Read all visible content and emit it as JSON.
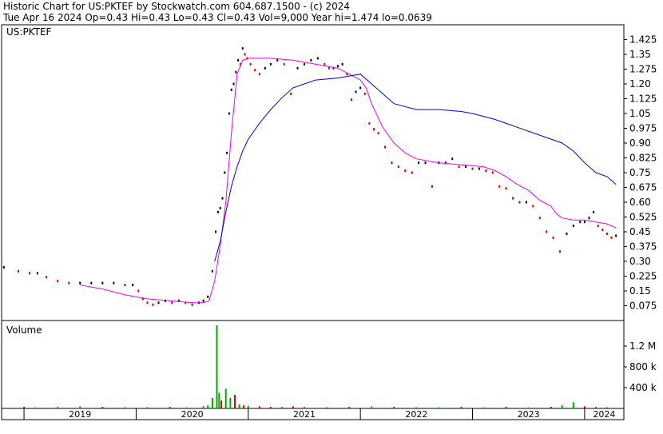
{
  "header": {
    "line1": "Historic Chart for US:PKTEF by Stockwatch.com 604.687.1500 - (c) 2024",
    "line2": "Tue Apr 16 2024  Op=0.43  Hi=0.43  Lo=0.43  Cl=0.43  Vol=9,000  Year hi=1.474  lo=0.0639"
  },
  "colors": {
    "up": "#000000",
    "down": "#cc0000",
    "ma_short": "#ee00ee",
    "ma_long": "#0000cc",
    "vol_up": "#00aa00",
    "vol_down": "#cc0000"
  },
  "chart_data": [
    {
      "type": "line",
      "symbol_label": "US:PKTEF",
      "x_ticks": [
        "2019",
        "2020",
        "2021",
        "2022",
        "2023",
        "2024"
      ],
      "x_range": [
        2018.8,
        2024.35
      ],
      "y_ticks": [
        "1.425",
        "1.35",
        "1.275",
        "1.20",
        "1.125",
        "1.05",
        "0.975",
        "0.90",
        "0.825",
        "0.75",
        "0.675",
        "0.60",
        "0.525",
        "0.45",
        "0.375",
        "0.30",
        "0.225",
        "0.15",
        "0.075"
      ],
      "ylim": [
        0,
        1.5
      ],
      "series": [
        {
          "name": "",
          "role": "close",
          "x": [
            2018.82,
            2018.95,
            2019.05,
            2019.12,
            2019.2,
            2019.3,
            2019.4,
            2019.5,
            2019.6,
            2019.7,
            2019.8,
            2019.9,
            2019.97,
            2020.02,
            2020.06,
            2020.1,
            2020.15,
            2020.2,
            2020.26,
            2020.32,
            2020.38,
            2020.44,
            2020.5,
            2020.56,
            2020.6,
            2020.64,
            2020.68,
            2020.71,
            2020.73,
            2020.75,
            2020.77,
            2020.79,
            2020.81,
            2020.83,
            2020.85,
            2020.87,
            2020.89,
            2020.91,
            2020.93,
            2020.95,
            2020.97,
            2020.99,
            2021.02,
            2021.06,
            2021.1,
            2021.15,
            2021.2,
            2021.26,
            2021.32,
            2021.38,
            2021.44,
            2021.5,
            2021.56,
            2021.62,
            2021.68,
            2021.72,
            2021.76,
            2021.8,
            2021.84,
            2021.88,
            2021.92,
            2021.96,
            2022.0,
            2022.04,
            2022.08,
            2022.12,
            2022.16,
            2022.22,
            2022.28,
            2022.34,
            2022.4,
            2022.46,
            2022.52,
            2022.58,
            2022.64,
            2022.7,
            2022.76,
            2022.82,
            2022.88,
            2022.94,
            2023.0,
            2023.06,
            2023.12,
            2023.18,
            2023.24,
            2023.3,
            2023.36,
            2023.42,
            2023.48,
            2023.54,
            2023.6,
            2023.66,
            2023.72,
            2023.78,
            2023.84,
            2023.9,
            2023.96,
            2024.0,
            2024.04,
            2024.08,
            2024.12,
            2024.16,
            2024.2,
            2024.24,
            2024.28
          ],
          "values": [
            0.27,
            0.25,
            0.24,
            0.24,
            0.22,
            0.2,
            0.19,
            0.19,
            0.19,
            0.19,
            0.19,
            0.18,
            0.18,
            0.15,
            0.11,
            0.09,
            0.08,
            0.09,
            0.1,
            0.09,
            0.1,
            0.09,
            0.08,
            0.09,
            0.1,
            0.12,
            0.25,
            0.45,
            0.55,
            0.57,
            0.62,
            0.75,
            0.85,
            1.05,
            1.17,
            1.2,
            1.26,
            1.32,
            1.3,
            1.38,
            1.35,
            1.33,
            1.3,
            1.27,
            1.25,
            1.28,
            1.3,
            1.32,
            1.3,
            1.15,
            1.28,
            1.3,
            1.32,
            1.33,
            1.3,
            1.28,
            1.28,
            1.29,
            1.3,
            1.25,
            1.12,
            1.16,
            1.18,
            1.15,
            1.0,
            0.97,
            0.95,
            0.88,
            0.8,
            0.78,
            0.76,
            0.75,
            0.8,
            0.8,
            0.68,
            0.8,
            0.8,
            0.82,
            0.78,
            0.78,
            0.77,
            0.77,
            0.76,
            0.75,
            0.68,
            0.67,
            0.62,
            0.6,
            0.6,
            0.58,
            0.52,
            0.45,
            0.42,
            0.35,
            0.44,
            0.48,
            0.5,
            0.5,
            0.52,
            0.55,
            0.48,
            0.46,
            0.44,
            0.42,
            0.43
          ]
        },
        {
          "name": "",
          "role": "moving-average-short",
          "x": [
            2019.5,
            2019.7,
            2019.9,
            2020.1,
            2020.3,
            2020.5,
            2020.6,
            2020.65,
            2020.7,
            2020.75,
            2020.8,
            2020.85,
            2020.9,
            2020.95,
            2021.0,
            2021.2,
            2021.4,
            2021.6,
            2021.8,
            2021.9,
            2022.0,
            2022.05,
            2022.1,
            2022.2,
            2022.3,
            2022.4,
            2022.5,
            2022.7,
            2022.9,
            2023.1,
            2023.2,
            2023.3,
            2023.4,
            2023.5,
            2023.6,
            2023.7,
            2023.75,
            2023.8,
            2023.9,
            2024.0,
            2024.1,
            2024.2,
            2024.28
          ],
          "values": [
            0.18,
            0.16,
            0.13,
            0.11,
            0.1,
            0.09,
            0.09,
            0.1,
            0.2,
            0.38,
            0.6,
            0.95,
            1.25,
            1.32,
            1.33,
            1.33,
            1.32,
            1.3,
            1.28,
            1.25,
            1.22,
            1.18,
            1.1,
            0.98,
            0.9,
            0.85,
            0.82,
            0.8,
            0.79,
            0.78,
            0.76,
            0.73,
            0.69,
            0.66,
            0.61,
            0.58,
            0.54,
            0.52,
            0.51,
            0.51,
            0.5,
            0.49,
            0.47
          ]
        },
        {
          "name": "",
          "role": "moving-average-long",
          "x": [
            2020.7,
            2020.75,
            2020.8,
            2020.85,
            2020.9,
            2020.95,
            2021.0,
            2021.1,
            2021.2,
            2021.3,
            2021.4,
            2021.5,
            2021.6,
            2021.8,
            2021.9,
            2022.0,
            2022.1,
            2022.2,
            2022.3,
            2022.5,
            2022.7,
            2022.9,
            2023.0,
            2023.2,
            2023.4,
            2023.6,
            2023.8,
            2023.9,
            2024.0,
            2024.1,
            2024.2,
            2024.28
          ],
          "values": [
            0.3,
            0.4,
            0.55,
            0.68,
            0.78,
            0.86,
            0.92,
            1.0,
            1.07,
            1.13,
            1.18,
            1.2,
            1.22,
            1.23,
            1.24,
            1.25,
            1.2,
            1.15,
            1.1,
            1.07,
            1.07,
            1.06,
            1.05,
            1.02,
            0.98,
            0.94,
            0.9,
            0.86,
            0.8,
            0.75,
            0.73,
            0.69
          ]
        }
      ]
    },
    {
      "type": "bar",
      "title": "Volume",
      "y_ticks": [
        "1.2 M",
        "800 k",
        "400 k"
      ],
      "ylim": [
        0,
        1600000
      ],
      "x": [
        2019.0,
        2019.1,
        2019.3,
        2019.5,
        2019.7,
        2019.9,
        2020.1,
        2020.3,
        2020.45,
        2020.6,
        2020.64,
        2020.68,
        2020.72,
        2020.74,
        2020.76,
        2020.8,
        2020.84,
        2020.88,
        2020.92,
        2020.96,
        2021.0,
        2021.1,
        2021.2,
        2021.3,
        2021.4,
        2021.5,
        2021.7,
        2021.9,
        2022.1,
        2022.3,
        2022.5,
        2022.7,
        2022.9,
        2023.1,
        2023.3,
        2023.5,
        2023.7,
        2023.8,
        2023.9,
        2024.0,
        2024.1,
        2024.2
      ],
      "values": [
        30000,
        20000,
        25000,
        40000,
        30000,
        20000,
        25000,
        30000,
        20000,
        40000,
        60000,
        200000,
        1600000,
        300000,
        150000,
        380000,
        200000,
        260000,
        80000,
        60000,
        50000,
        40000,
        30000,
        30000,
        40000,
        30000,
        20000,
        30000,
        40000,
        30000,
        20000,
        20000,
        30000,
        20000,
        30000,
        20000,
        30000,
        60000,
        120000,
        40000,
        30000,
        20000
      ],
      "colors": [
        "r",
        "g",
        "r",
        "g",
        "r",
        "r",
        "g",
        "r",
        "g",
        "g",
        "g",
        "g",
        "g",
        "g",
        "r",
        "g",
        "g",
        "r",
        "g",
        "r",
        "g",
        "r",
        "r",
        "g",
        "r",
        "g",
        "r",
        "r",
        "g",
        "r",
        "r",
        "g",
        "r",
        "g",
        "r",
        "g",
        "r",
        "g",
        "g",
        "r",
        "g",
        "r"
      ]
    }
  ]
}
